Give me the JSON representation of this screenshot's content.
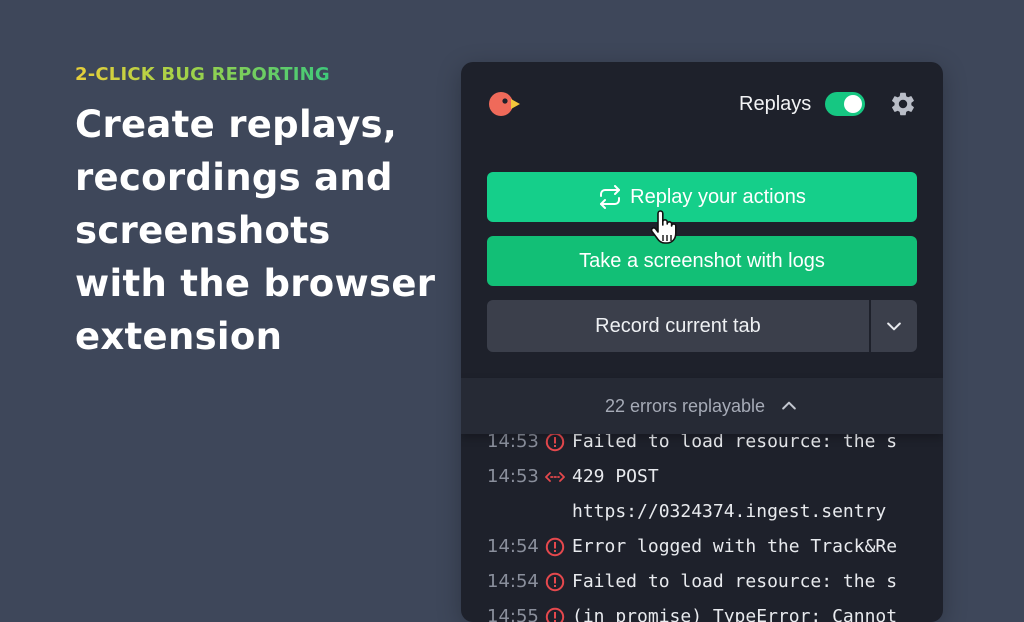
{
  "hero": {
    "eyebrow": "2-CLICK BUG REPORTING",
    "headline_lines": [
      "Create replays,",
      "recordings and",
      "screenshots",
      "with the browser",
      "extension"
    ]
  },
  "popup": {
    "header": {
      "replays_label": "Replays",
      "replays_enabled": true
    },
    "buttons": {
      "replay": "Replay your actions",
      "screenshot": "Take a screenshot with logs",
      "record": "Record current tab"
    },
    "errors_summary": "22 errors replayable",
    "log": [
      {
        "time": "14:53",
        "icon": "error-circle-icon",
        "text": "Failed to load resource: the s"
      },
      {
        "time": "14:53",
        "icon": "network-arrows-icon",
        "text": "429 POST"
      },
      {
        "time": "",
        "icon": "",
        "text": "https://0324374.ingest.sentry"
      },
      {
        "time": "14:54",
        "icon": "error-circle-icon",
        "text": "Error logged with the Track&Re"
      },
      {
        "time": "14:54",
        "icon": "error-circle-icon",
        "text": "Failed to load resource: the s"
      },
      {
        "time": "14:55",
        "icon": "error-circle-icon",
        "text": "(in promise) TypeError: Cannot"
      }
    ]
  },
  "colors": {
    "background": "#3e475a",
    "popup": "#1e212b",
    "accent_green": "#15cf8a",
    "secondary_button": "#3b3f4b",
    "error_red": "#e5484d"
  }
}
